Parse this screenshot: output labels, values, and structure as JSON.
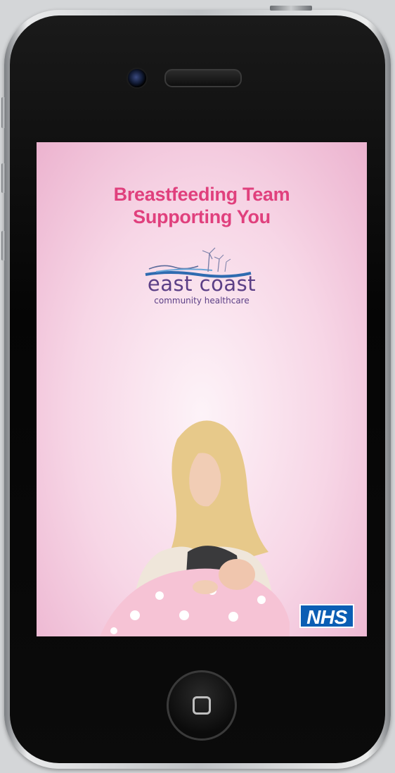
{
  "app": {
    "title_line1": "Breastfeeding Team",
    "title_line2": "Supporting You"
  },
  "logo": {
    "main": "east coast",
    "sub": "community healthcare"
  },
  "badge": {
    "nhs": "NHS"
  },
  "colors": {
    "title_pink": "#e0407d",
    "logo_purple": "#5b3f86",
    "nhs_blue": "#0b5eb4",
    "screen_pink": "#f7d6e6"
  },
  "icons": {
    "camera": "front-camera-icon",
    "speaker": "earpiece-speaker-icon",
    "home": "home-button-icon"
  }
}
